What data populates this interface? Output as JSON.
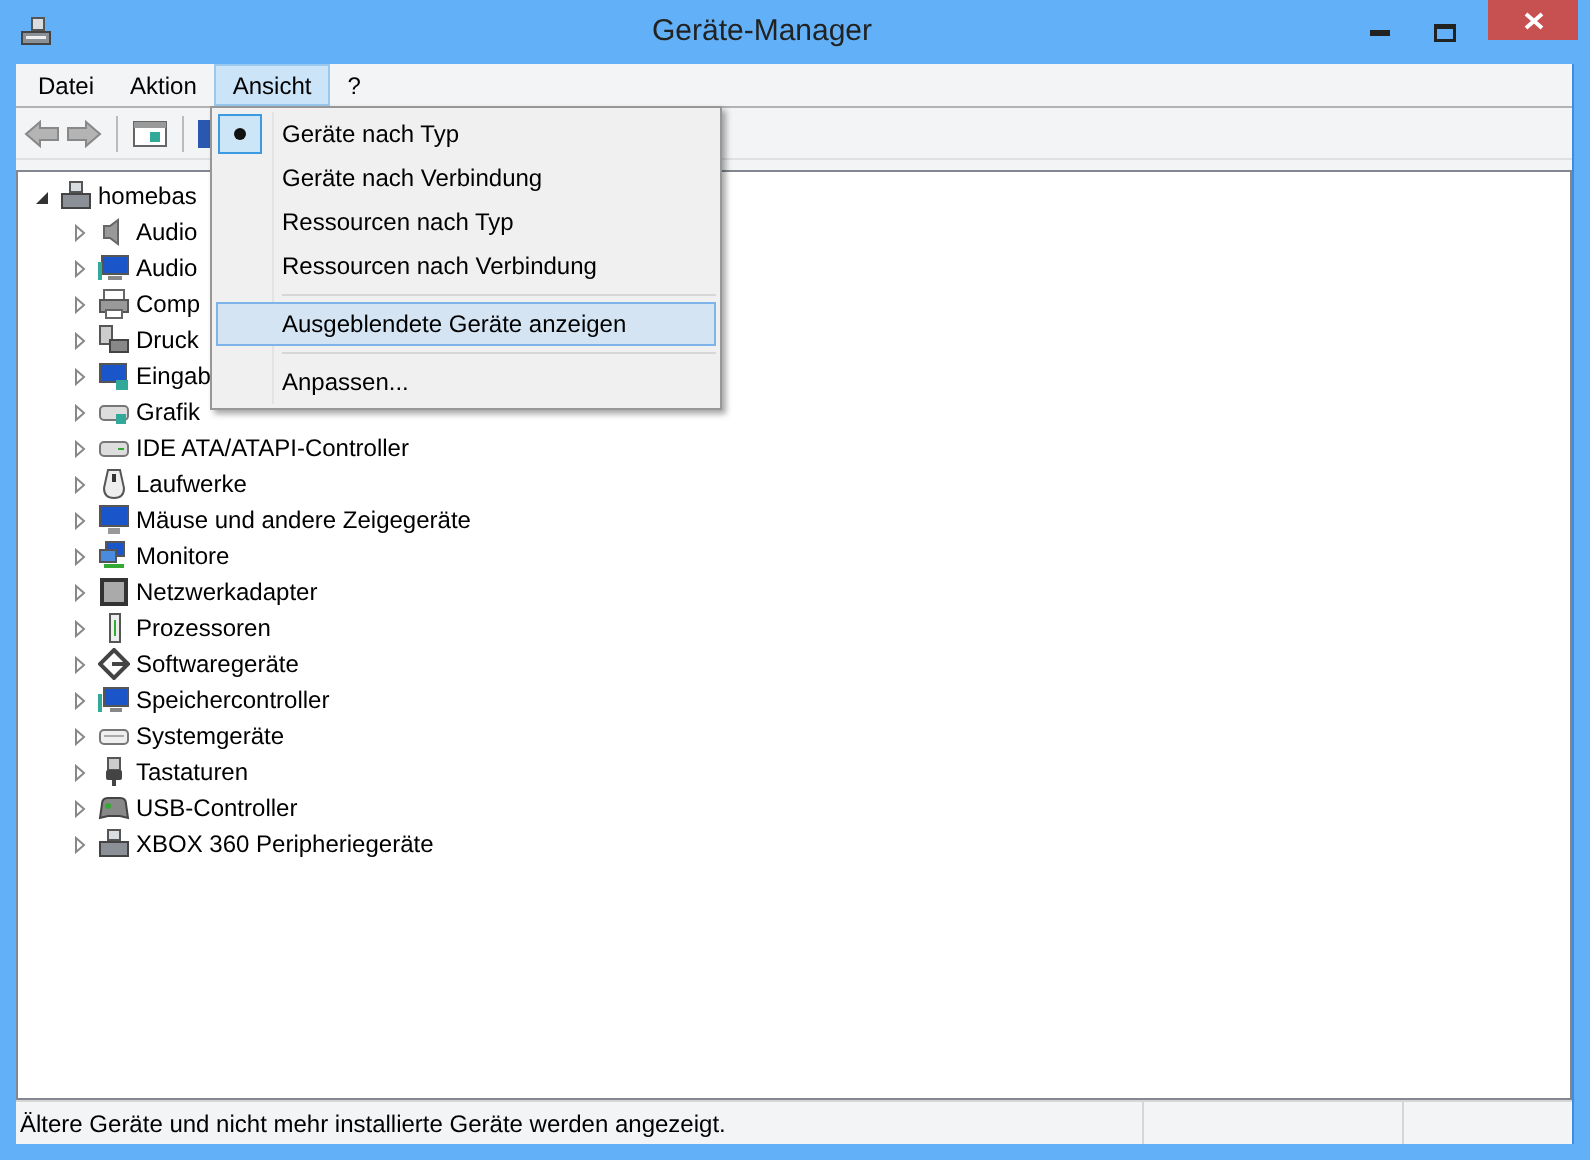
{
  "window": {
    "title": "Geräte-Manager"
  },
  "menubar": [
    {
      "label": "Datei",
      "selected": false
    },
    {
      "label": "Aktion",
      "selected": false
    },
    {
      "label": "Ansicht",
      "selected": true
    },
    {
      "label": "?",
      "selected": false
    }
  ],
  "menu": {
    "groups": [
      [
        {
          "label": "Geräte nach Typ",
          "checked": true,
          "highlighted": false
        },
        {
          "label": "Geräte nach Verbindung",
          "checked": false,
          "highlighted": false
        },
        {
          "label": "Ressourcen nach Typ",
          "checked": false,
          "highlighted": false
        },
        {
          "label": "Ressourcen nach Verbindung",
          "checked": false,
          "highlighted": false
        }
      ],
      [
        {
          "label": "Ausgeblendete Geräte anzeigen",
          "checked": false,
          "highlighted": true
        }
      ],
      [
        {
          "label": "Anpassen...",
          "checked": false,
          "highlighted": false
        }
      ]
    ]
  },
  "tree": [
    {
      "label": "homebas",
      "expanded": true,
      "children": [
        {
          "label": "Audio",
          "expanded": false
        },
        {
          "label": "Audio",
          "expanded": false
        },
        {
          "label": "Comp",
          "expanded": false
        },
        {
          "label": "Druck",
          "expanded": false
        },
        {
          "label": "Eingab",
          "expanded": false
        },
        {
          "label": "Grafik",
          "expanded": false
        },
        {
          "label": "IDE ATA/ATAPI-Controller",
          "expanded": false
        },
        {
          "label": "Laufwerke",
          "expanded": false
        },
        {
          "label": "Mäuse und andere Zeigegeräte",
          "expanded": false
        },
        {
          "label": "Monitore",
          "expanded": false
        },
        {
          "label": "Netzwerkadapter",
          "expanded": false
        },
        {
          "label": "Prozessoren",
          "expanded": false
        },
        {
          "label": "Softwaregeräte",
          "expanded": false
        },
        {
          "label": "Speichercontroller",
          "expanded": false
        },
        {
          "label": "Systemgeräte",
          "expanded": false
        },
        {
          "label": "Tastaturen",
          "expanded": false
        },
        {
          "label": "USB-Controller",
          "expanded": false
        },
        {
          "label": "XBOX 360 Peripheriegeräte",
          "expanded": false
        }
      ]
    }
  ],
  "status_bar": {
    "text": "Ältere Geräte und nicht mehr installierte Geräte werden angezeigt."
  }
}
